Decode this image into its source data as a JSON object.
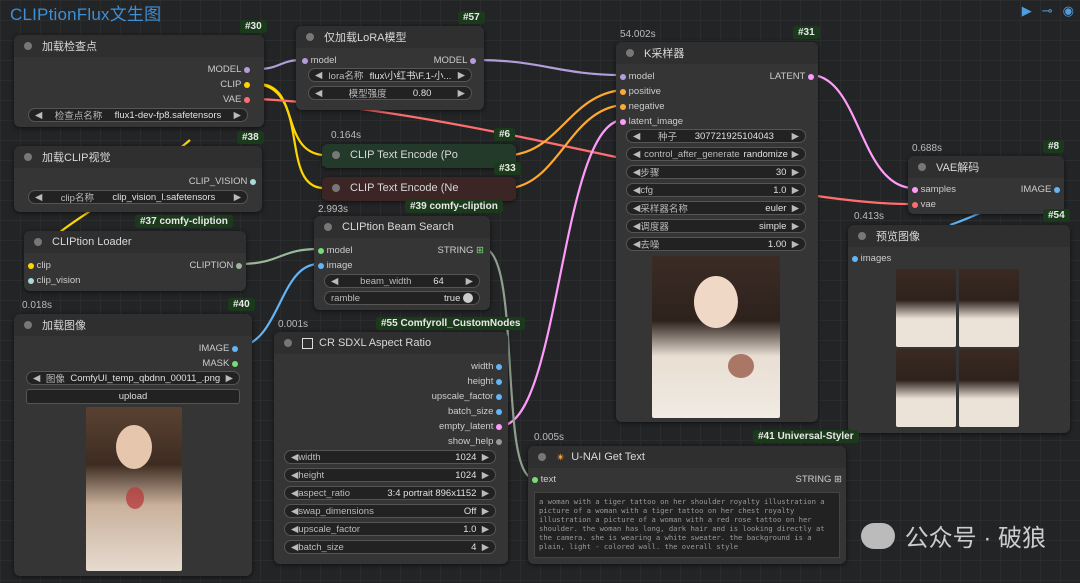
{
  "app_title": "CLIPtionFlux文生图",
  "top_icons": [
    "play-icon",
    "link-icon",
    "eye-icon"
  ],
  "nodes": {
    "checkpoint": {
      "id": "#30",
      "title": "加载检查点",
      "outputs": [
        "MODEL",
        "CLIP",
        "VAE"
      ],
      "widget": {
        "label": "检查点名称",
        "value": "flux1-dev-fp8.safetensors"
      }
    },
    "lora": {
      "id": "#57",
      "title": "仅加载LoRA模型",
      "in_port": "model",
      "out_port": "MODEL",
      "widgets": [
        {
          "label": "lora名称",
          "value": "flux\\小红书\\F.1-小..."
        },
        {
          "label": "模型强度",
          "value": "0.80"
        }
      ]
    },
    "clip_encode_pos": {
      "id": "#6",
      "time": "0.164s",
      "title": "CLIP Text Encode (Po"
    },
    "clip_encode_neg": {
      "id": "#33",
      "title": "CLIP Text Encode (Ne"
    },
    "clip_vision": {
      "id": "#38",
      "title": "加载CLIP视觉",
      "out_port": "CLIP_VISION",
      "widget": {
        "label": "clip名称",
        "value": "clip_vision_l.safetensors"
      }
    },
    "cliption_loader": {
      "id": "#37 comfy-cliption",
      "title": "CLIPtion Loader",
      "inputs": [
        "clip",
        "clip_vision"
      ],
      "out_port": "CLIPTION"
    },
    "beam_search": {
      "id": "#39 comfy-cliption",
      "time": "2.993s",
      "title": "CLIPtion Beam Search",
      "inputs": [
        "model",
        "image"
      ],
      "out_port": "STRING",
      "widgets": [
        {
          "label": "beam_width",
          "value": "64"
        },
        {
          "label": "ramble",
          "value": "true"
        }
      ]
    },
    "load_image": {
      "id": "#40",
      "time": "0.018s",
      "title": "加载图像",
      "outputs": [
        "IMAGE",
        "MASK"
      ],
      "widget": {
        "label": "图像",
        "value": "ComfyUI_temp_qbdnn_00011_.png"
      },
      "button": "upload"
    },
    "aspect_ratio": {
      "id": "#55 Comfyroll_CustomNodes",
      "time": "0.001s",
      "title": "CR SDXL Aspect Ratio",
      "outputs": [
        "width",
        "height",
        "upscale_factor",
        "batch_size",
        "empty_latent",
        "show_help"
      ],
      "widgets": [
        {
          "label": "width",
          "value": "1024"
        },
        {
          "label": "height",
          "value": "1024"
        },
        {
          "label": "aspect_ratio",
          "value": "3:4 portrait 896x1152"
        },
        {
          "label": "swap_dimensions",
          "value": "Off"
        },
        {
          "label": "upscale_factor",
          "value": "1.0"
        },
        {
          "label": "batch_size",
          "value": "4"
        }
      ]
    },
    "ksampler": {
      "id": "#31",
      "time": "54.002s",
      "title": "K采样器",
      "inputs": [
        "model",
        "positive",
        "negative",
        "latent_image"
      ],
      "out_port": "LATENT",
      "widgets": [
        {
          "label": "种子",
          "value": "307721925104043"
        },
        {
          "label": "control_after_generate",
          "value": "randomize"
        },
        {
          "label": "步骤",
          "value": "30"
        },
        {
          "label": "cfg",
          "value": "1.0"
        },
        {
          "label": "采样器名称",
          "value": "euler"
        },
        {
          "label": "调度器",
          "value": "simple"
        },
        {
          "label": "去噪",
          "value": "1.00"
        }
      ]
    },
    "vae_decode": {
      "id": "#8",
      "time": "0.688s",
      "title": "VAE解码",
      "inputs": [
        "samples",
        "vae"
      ],
      "out_port": "IMAGE"
    },
    "preview": {
      "id": "#54",
      "time": "0.413s",
      "title": "预览图像",
      "in_port": "images"
    },
    "get_text": {
      "id": "#41 Universal-Styler",
      "time": "0.005s",
      "title": "U-NAI Get Text",
      "in_port": "text",
      "out_port": "STRING",
      "text": "a woman with a tiger tattoo on her shoulder royalty illustration a picture of a woman with a tiger tattoo on her chest royalty illustration a picture of a woman with a red rose tattoo on her shoulder. the woman has long, dark hair and is looking directly at the camera. she is wearing a white sweater. the background is a plain, light - colored wall. the overall style"
    }
  },
  "watermark": "公众号 · 破狼",
  "colors": {
    "model": "#b39ddb",
    "clip": "#ffd500",
    "vae": "#ff6e6e",
    "image": "#64b5f6",
    "conditioning": "#ffa931",
    "latent": "#ff9cf9",
    "string": "#77dd77",
    "clip_vision": "#a8dadc"
  }
}
